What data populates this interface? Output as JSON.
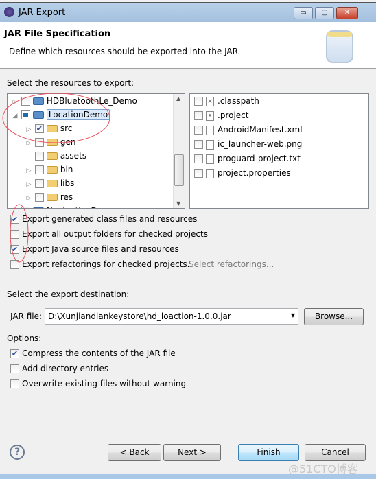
{
  "window": {
    "title": "JAR Export",
    "minimize": "▭",
    "maximize": "▢",
    "close": "✕"
  },
  "header": {
    "title": "JAR File Specification",
    "description": "Define which resources should be exported into the JAR."
  },
  "resources": {
    "label": "Select the resources to export:",
    "tree": [
      {
        "label": "HDBluetoothLe_Demo",
        "level": 0,
        "expander": "collapsed",
        "checked": false
      },
      {
        "label": "LocationDemo",
        "level": 0,
        "expander": "expanded",
        "checked": "partial",
        "selected": true
      },
      {
        "label": "src",
        "level": 1,
        "expander": "collapsed",
        "checked": true
      },
      {
        "label": "gen",
        "level": 1,
        "expander": "collapsed",
        "checked": false
      },
      {
        "label": "assets",
        "level": 1,
        "expander": "none",
        "checked": false
      },
      {
        "label": "bin",
        "level": 1,
        "expander": "collapsed",
        "checked": false
      },
      {
        "label": "libs",
        "level": 1,
        "expander": "collapsed",
        "checked": false
      },
      {
        "label": "res",
        "level": 1,
        "expander": "collapsed",
        "checked": false
      },
      {
        "label": "NavigationD",
        "level": 0,
        "expander": "collapsed",
        "checked": false
      }
    ],
    "files": [
      {
        "label": ".classpath",
        "checked": false
      },
      {
        "label": ".project",
        "checked": false
      },
      {
        "label": "AndroidManifest.xml",
        "checked": false
      },
      {
        "label": "ic_launcher-web.png",
        "checked": false
      },
      {
        "label": "proguard-project.txt",
        "checked": false
      },
      {
        "label": "project.properties",
        "checked": false
      }
    ]
  },
  "export_options": [
    {
      "label": "Export generated class files and resources",
      "checked": true
    },
    {
      "label": "Export all output folders for checked projects",
      "checked": false
    },
    {
      "label": "Export Java source files and resources",
      "checked": true
    },
    {
      "label": "Export refactorings for checked projects.",
      "checked": false
    }
  ],
  "select_refactorings": "Select refactorings...",
  "destination": {
    "label": "Select the export destination:",
    "jar_label": "JAR file:",
    "jar_value": "D:\\Xunjiandiankeystore\\hd_loaction-1.0.0.jar",
    "browse": "Browse..."
  },
  "options": {
    "label": "Options:",
    "items": [
      {
        "label": "Compress the contents of the JAR file",
        "checked": true
      },
      {
        "label": "Add directory entries",
        "checked": false
      },
      {
        "label": "Overwrite existing files without warning",
        "checked": false
      }
    ]
  },
  "buttons": {
    "help": "?",
    "back": "< Back",
    "next": "Next >",
    "finish": "Finish",
    "cancel": "Cancel"
  },
  "watermark": "@51CTO博客",
  "annotation_color": "#e8505b"
}
